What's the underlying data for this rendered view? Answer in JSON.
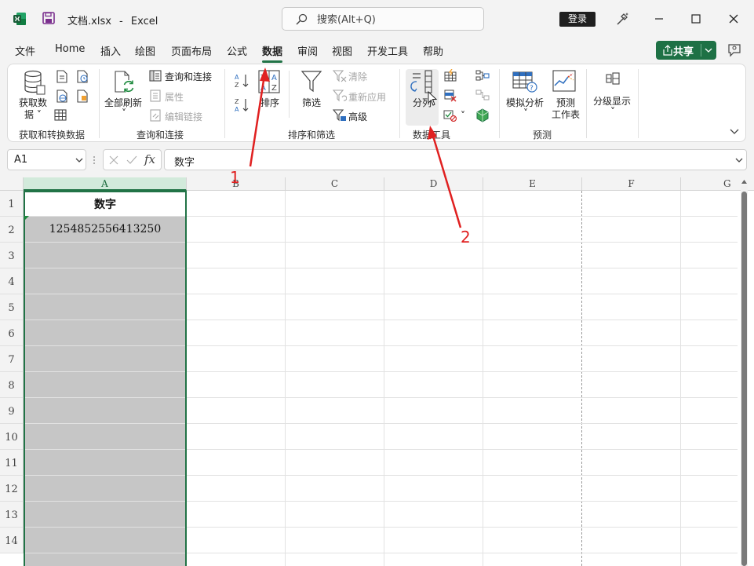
{
  "titlebar": {
    "file_name": "文档.xlsx",
    "separator": "-",
    "app_name": "Excel",
    "search_placeholder": "搜索(Alt+Q)",
    "login_label": "登录"
  },
  "menu": {
    "tabs": [
      "文件",
      "Home",
      "插入",
      "绘图",
      "页面布局",
      "公式",
      "数据",
      "审阅",
      "视图",
      "开发工具",
      "帮助"
    ],
    "active_tab": "数据",
    "share_label": "共享"
  },
  "ribbon": {
    "get_transform": {
      "get_data_line1": "获取数",
      "get_data_line2": "据",
      "group_label": "获取和转换数据"
    },
    "queries": {
      "refresh_all": "全部刷新",
      "queries_connections": "查询和连接",
      "properties": "属性",
      "edit_links": "编辑链接",
      "group_label": "查询和连接"
    },
    "sort_filter": {
      "sort": "排序",
      "filter": "筛选",
      "clear": "清除",
      "reapply": "重新应用",
      "advanced": "高级",
      "group_label": "排序和筛选"
    },
    "data_tools": {
      "text_to_columns": "分列",
      "group_label": "数据工具"
    },
    "forecast": {
      "what_if": "模拟分析",
      "forecast_line1": "预测",
      "forecast_line2": "工作表",
      "group_label": "预测"
    },
    "outline": {
      "outline_label": "分级显示"
    }
  },
  "formula_bar": {
    "name_box": "A1",
    "fx_label": "fx",
    "formula_value": "数字"
  },
  "sheet": {
    "columns": [
      "A",
      "B",
      "C",
      "D",
      "E",
      "F",
      "G"
    ],
    "rows": [
      "1",
      "2",
      "3",
      "4",
      "5",
      "6",
      "7",
      "8",
      "9",
      "10",
      "11",
      "12",
      "13",
      "14"
    ],
    "cells": {
      "A1": "数字",
      "A2": "1254852556413250"
    }
  },
  "annotations": {
    "label_1": "1",
    "label_2": "2",
    "color": "#e02020"
  },
  "colors": {
    "excel_green": "#217346",
    "share_button": "#1e7145"
  }
}
